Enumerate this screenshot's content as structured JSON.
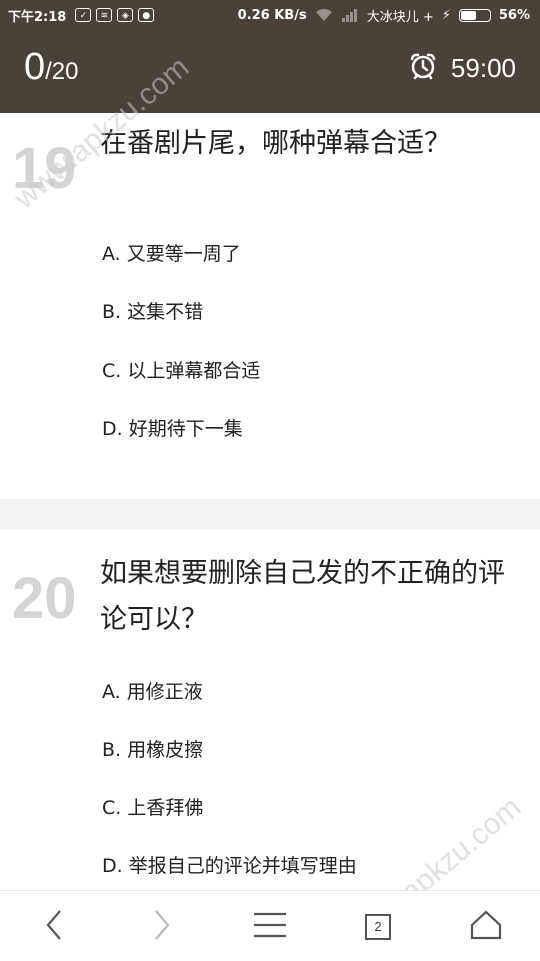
{
  "status": {
    "time": "下午2:18",
    "speed": "0.26 KB/s",
    "carrier": "大冰块儿 +",
    "battery_pct": "56%",
    "battery_level": 0.56
  },
  "header": {
    "score": "0",
    "total": "/20",
    "timer": "59:00"
  },
  "questions": [
    {
      "number": "19",
      "text": "在番剧片尾，哪种弹幕合适？",
      "options": [
        "A. 又要等一周了",
        "B. 这集不错",
        "C. 以上弹幕都合适",
        "D. 好期待下一集"
      ]
    },
    {
      "number": "20",
      "text": "如果想要删除自己发的不正确的评论可以？",
      "options": [
        "A. 用修正液",
        "B. 用橡皮擦",
        "C. 上香拜佛",
        "D. 举报自己的评论并填写理由"
      ]
    }
  ],
  "watermark": "www.apkzu.com",
  "nav": {
    "tab_count": "2"
  }
}
